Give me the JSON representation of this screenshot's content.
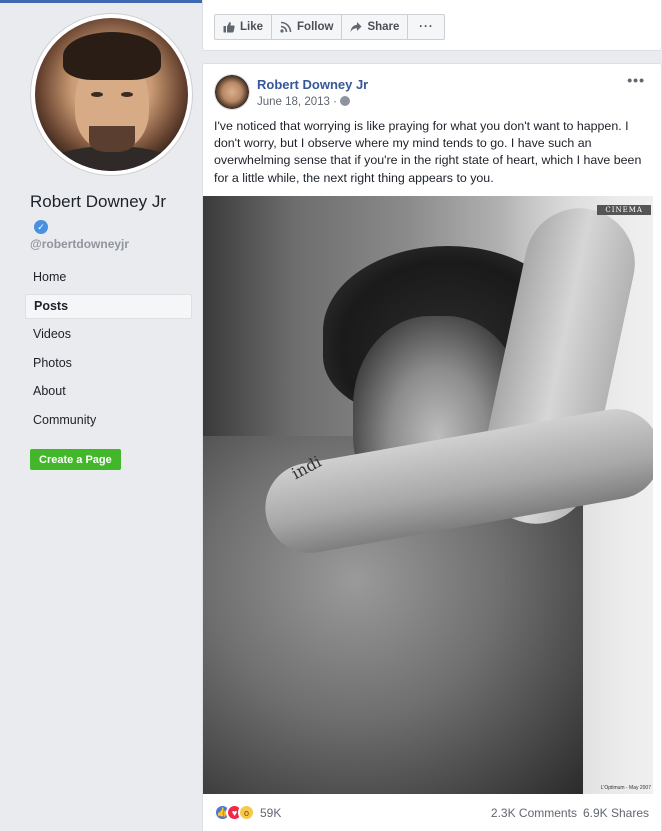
{
  "page": {
    "name": "Robert Downey Jr",
    "handle": "@robertdowneyjr"
  },
  "nav": {
    "items": [
      {
        "label": "Home",
        "active": false
      },
      {
        "label": "Posts",
        "active": true
      },
      {
        "label": "Videos",
        "active": false
      },
      {
        "label": "Photos",
        "active": false
      },
      {
        "label": "About",
        "active": false
      },
      {
        "label": "Community",
        "active": false
      }
    ],
    "create_page": "Create a Page"
  },
  "actions": {
    "like": "Like",
    "follow": "Follow",
    "share": "Share",
    "more": "···"
  },
  "post": {
    "author": "Robert Downey Jr",
    "date": "June 18, 2013 ·",
    "menu": "•••",
    "text": "I've noticed that worrying is like praying for what you don't want to happen. I don't worry, but I observe where my mind tends to go. I have such an overwhelming sense that if you're in the right state of heart, which I have been for a little while, the next right thing appears to you.",
    "photo": {
      "badge": "CINEMA",
      "tattoo": "indi",
      "credit": "L'Optimum - May 2007"
    },
    "reactions_count": "59K",
    "comments": "2.3K Comments",
    "shares": "6.9K Shares"
  },
  "icons": {
    "verified": "verified-badge-icon",
    "like": "thumbs-up-icon",
    "follow": "rss-icon",
    "share": "share-arrow-icon",
    "privacy": "globe-icon"
  },
  "colors": {
    "link": "#365899",
    "accent": "#4267b2",
    "create_button": "#42b72a",
    "background": "#e9ebee"
  }
}
